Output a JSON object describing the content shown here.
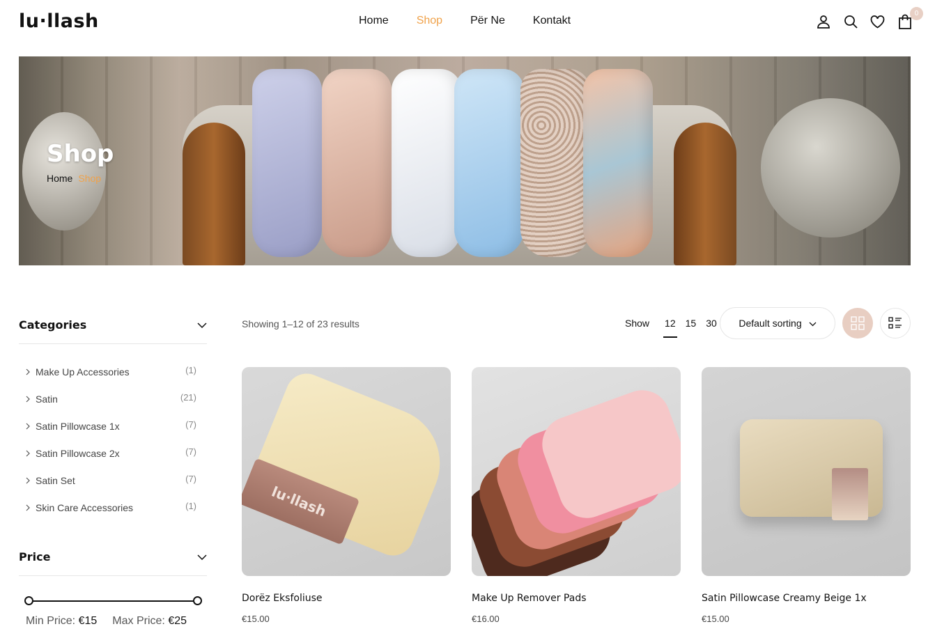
{
  "brand": {
    "logo": "lu·llash"
  },
  "nav": {
    "items": [
      {
        "label": "Home",
        "active": false
      },
      {
        "label": "Shop",
        "active": true
      },
      {
        "label": "Për Ne",
        "active": false
      },
      {
        "label": "Kontakt",
        "active": false
      }
    ]
  },
  "header_icons": [
    "user-icon",
    "search-icon",
    "heart-icon",
    "cart-icon"
  ],
  "cart": {
    "count": "0"
  },
  "hero": {
    "title": "Shop",
    "breadcrumb": {
      "home": "Home",
      "current": "Shop"
    }
  },
  "sidebar": {
    "categories_title": "Categories",
    "categories": [
      {
        "name": "Make Up Accessories",
        "count": "(1)"
      },
      {
        "name": "Satin",
        "count": "(21)"
      },
      {
        "name": "Satin Pillowcase 1x",
        "count": "(7)"
      },
      {
        "name": "Satin Pillowcase 2x",
        "count": "(7)"
      },
      {
        "name": "Satin Set",
        "count": "(7)"
      },
      {
        "name": "Skin Care Accessories",
        "count": "(1)"
      }
    ],
    "price_title": "Price",
    "min_label": "Min Price:",
    "min_value": "€15",
    "max_label": "Max Price:",
    "max_value": "€25"
  },
  "toolbar": {
    "results": "Showing 1–12 of 23 results",
    "show_label": "Show",
    "show_options": [
      "12",
      "15",
      "30"
    ],
    "show_selected": "12",
    "sorting": "Default sorting"
  },
  "products": [
    {
      "name": "Dorëz Eksfoliuse",
      "price": "€15.00",
      "band_text": "lu·llash"
    },
    {
      "name": "Make Up Remover Pads",
      "price": "€16.00"
    },
    {
      "name": "Satin Pillowcase Creamy Beige 1x",
      "price": "€15.00"
    }
  ],
  "colors": {
    "accent": "#f0a24a",
    "grid_active_bg": "#e8cec2",
    "text": "#111111"
  }
}
